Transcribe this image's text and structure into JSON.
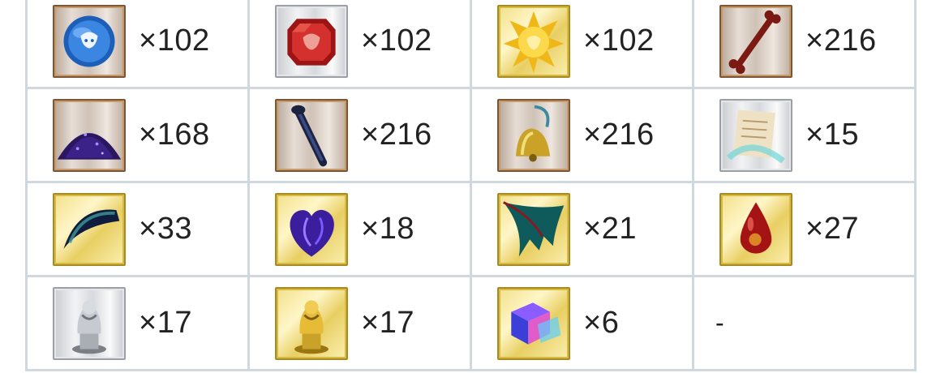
{
  "rows": [
    [
      {
        "icon": "blue-gem-icon",
        "count": "×102"
      },
      {
        "icon": "red-gem-icon",
        "count": "×102"
      },
      {
        "icon": "gold-gem-icon",
        "count": "×102"
      },
      {
        "icon": "bone-icon",
        "count": "×216"
      }
    ],
    [
      {
        "icon": "dust-pile-icon",
        "count": "×168"
      },
      {
        "icon": "fang-spike-icon",
        "count": "×216"
      },
      {
        "icon": "bell-icon",
        "count": "×216"
      },
      {
        "icon": "scroll-icon",
        "count": "×15"
      }
    ],
    [
      {
        "icon": "claw-icon",
        "count": "×33"
      },
      {
        "icon": "heart-icon",
        "count": "×18"
      },
      {
        "icon": "wing-icon",
        "count": "×21"
      },
      {
        "icon": "blood-drop-icon",
        "count": "×27"
      }
    ],
    [
      {
        "icon": "silver-statue-icon",
        "count": "×17"
      },
      {
        "icon": "gold-statue-icon",
        "count": "×17"
      },
      {
        "icon": "crystal-cube-icon",
        "count": "×6"
      },
      {
        "icon": "",
        "count": "-"
      }
    ]
  ]
}
